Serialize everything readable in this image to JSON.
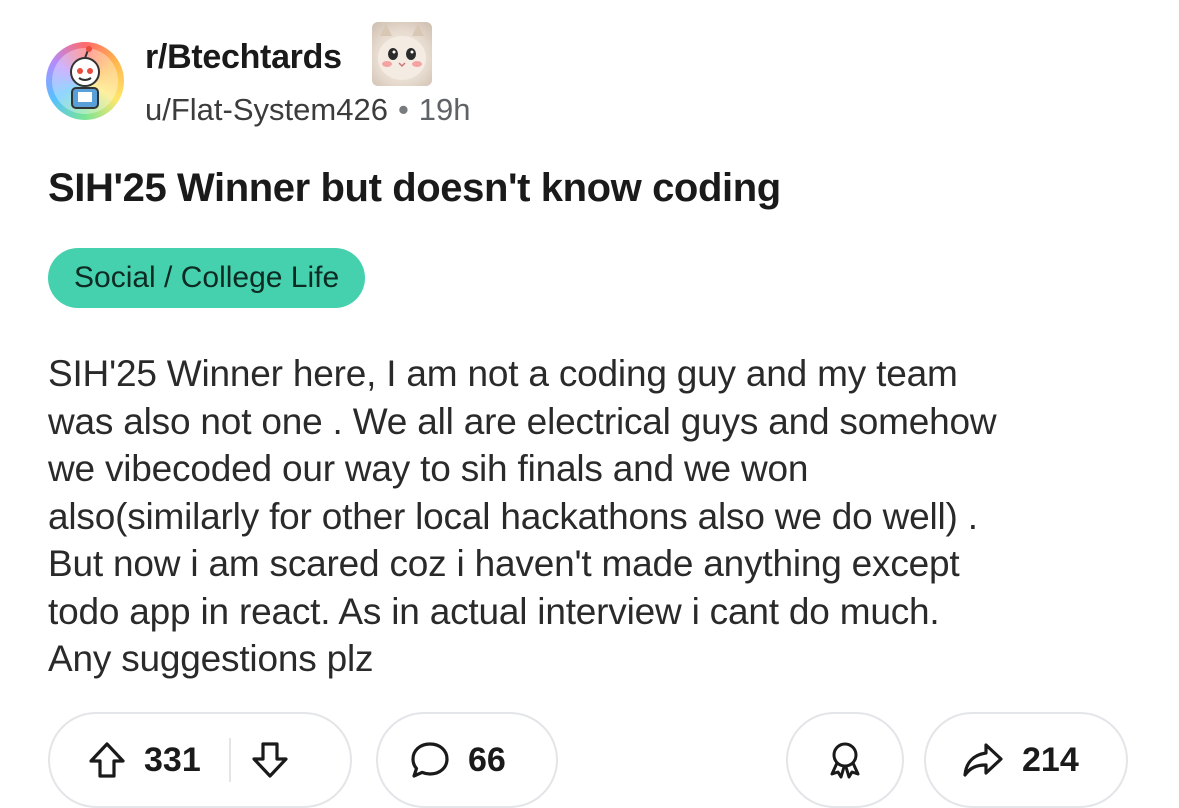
{
  "post": {
    "subreddit": "r/Btechtards",
    "author": "u/Flat-System426",
    "separator": "•",
    "age": "19h",
    "title": "SIH'25 Winner but doesn't know coding",
    "flair": "Social / College Life",
    "flair_color": "#46d1ae",
    "body_lines": [
      "SIH'25 Winner here, I am not a coding guy and my team",
      "was also not one . We all are electrical guys and somehow",
      "we vibecoded our way to sih finals and we won",
      "also(similarly for other local hackathons also we do well) .",
      "But now i am scared coz i haven't made anything except",
      "todo app in react. As in actual interview i cant do much.",
      "Any suggestions plz"
    ]
  },
  "actions": {
    "upvote_icon": "upvote-arrow-icon",
    "score": "331",
    "downvote_icon": "downvote-arrow-icon",
    "comment_icon": "comment-bubble-icon",
    "comments": "66",
    "award_icon": "award-icon",
    "share_icon": "share-arrow-icon",
    "shares": "214"
  }
}
